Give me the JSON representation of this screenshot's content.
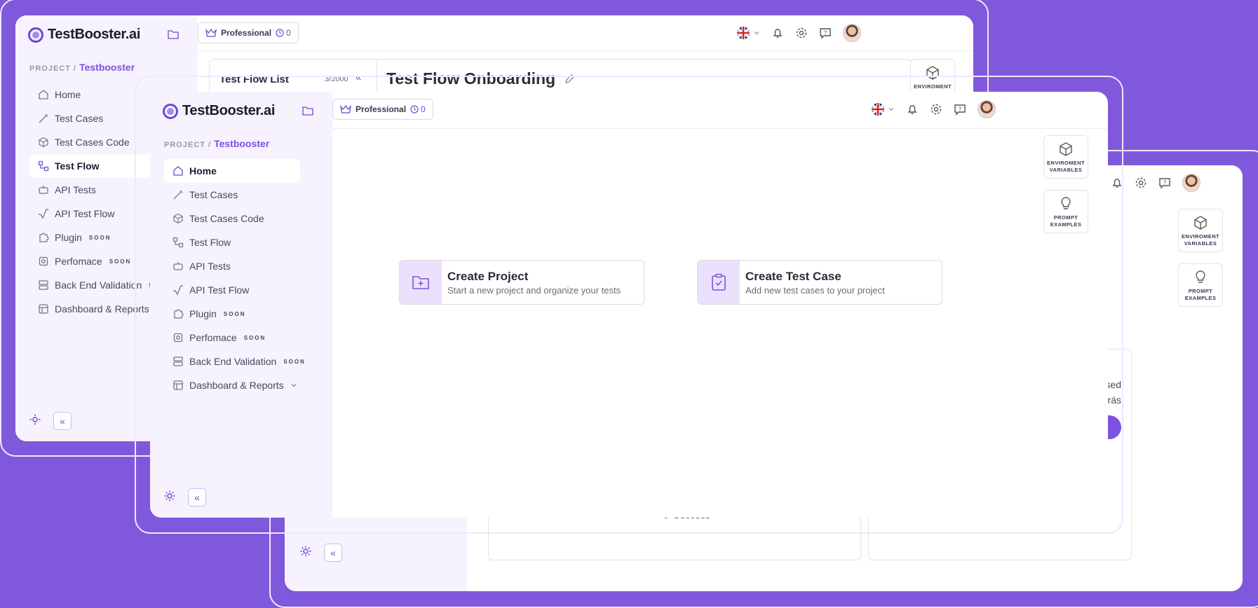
{
  "brand": "TestBooster.ai",
  "project": {
    "label": "PROJECT /",
    "name": "Testbooster"
  },
  "plan": {
    "name": "Professional",
    "count": "0"
  },
  "soon_tag": "SOON",
  "nav": [
    {
      "key": "home",
      "label": "Home"
    },
    {
      "key": "test-cases",
      "label": "Test Cases"
    },
    {
      "key": "test-cases-code",
      "label": "Test Cases Code"
    },
    {
      "key": "test-flow",
      "label": "Test Flow"
    },
    {
      "key": "api-tests",
      "label": "API Tests"
    },
    {
      "key": "api-test-flow",
      "label": "API Test Flow"
    },
    {
      "key": "plugin",
      "label": "Plugin"
    },
    {
      "key": "perfomace",
      "label": "Perfomace"
    },
    {
      "key": "back-end-validation",
      "label": "Back End Validation"
    },
    {
      "key": "dashboard-reports",
      "label": "Dashboard & Reports"
    }
  ],
  "side_cards": {
    "env_line1": "ENVIROMENT",
    "env_line2": "VARIABLES",
    "prompt_line1": "PROMPT",
    "prompt_line2": "EXAMPLES"
  },
  "back_window": {
    "flow_list_title": "Test Flow List",
    "flow_list_count": "3/2000",
    "flow_title": "Test Flow Onboarding",
    "env_card": "ENVIROMENT"
  },
  "third_window": {
    "status_paused": "Paused",
    "status_time": "...tos atrás",
    "legend_success": "Success"
  },
  "quick_actions": [
    {
      "title": "Create Project",
      "desc": "Start a new project and organize your tests"
    },
    {
      "title": "Create Test Case",
      "desc": "Add new test cases to your project"
    }
  ],
  "colors": {
    "accent": "#7c52e0",
    "background": "#8058db",
    "sidebar": "#f6f2fe",
    "success": "#0f9d58"
  }
}
